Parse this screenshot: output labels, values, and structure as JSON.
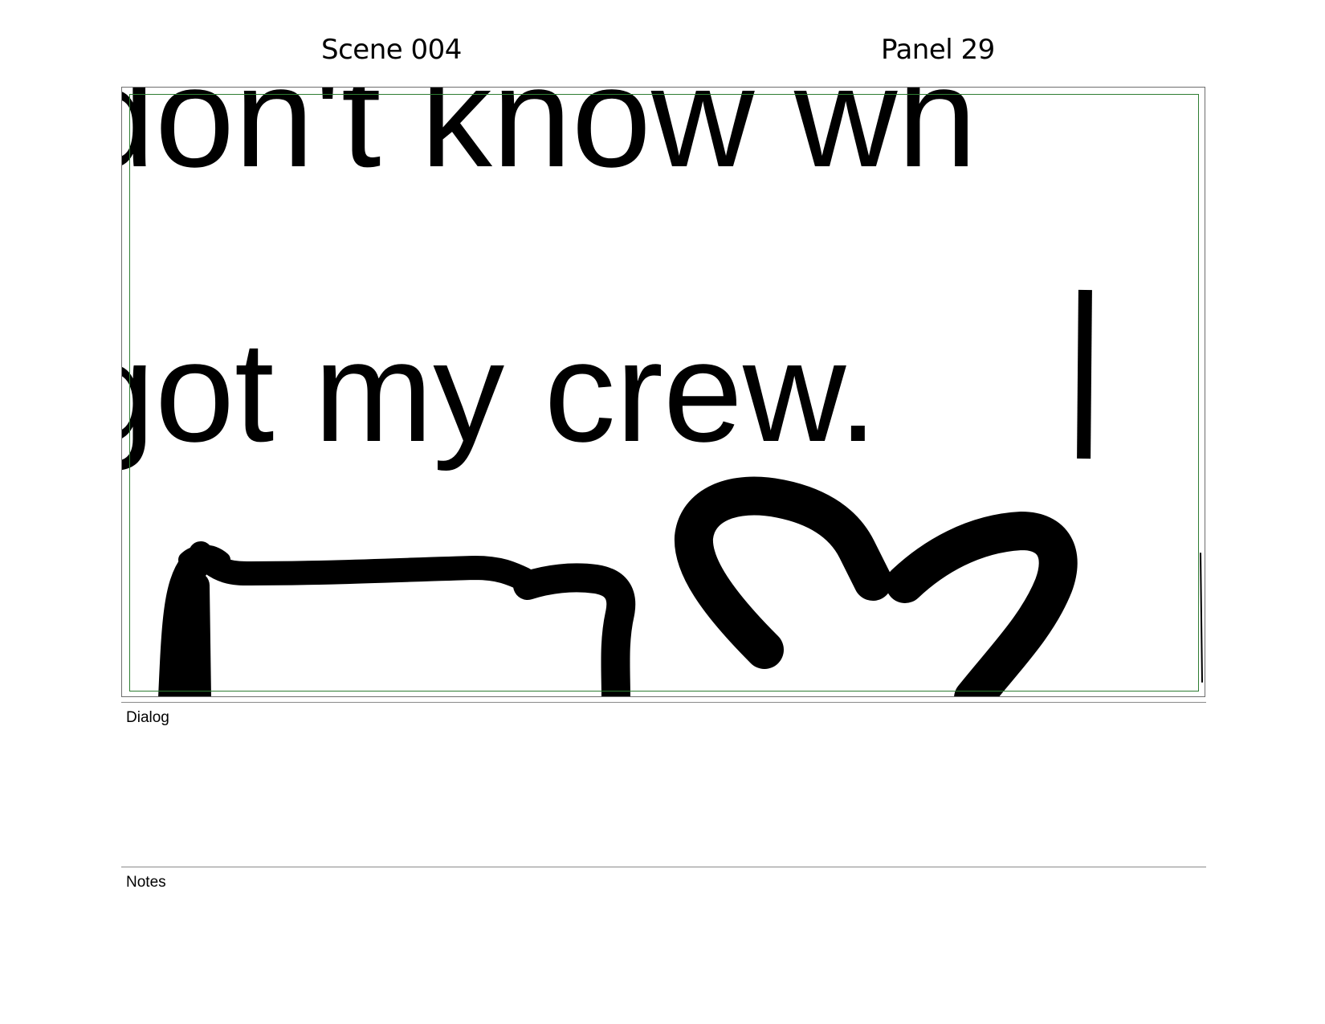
{
  "header": {
    "scene": "Scene 004",
    "panel": "Panel 29"
  },
  "panel": {
    "line_1": "don't know wh",
    "line_2": "got my crew.",
    "frame_color": "#6e6e6e",
    "safe_area_color": "#2e7d32"
  },
  "dialog": {
    "label": "Dialog",
    "text": ""
  },
  "notes": {
    "label": "Notes",
    "text": ""
  }
}
